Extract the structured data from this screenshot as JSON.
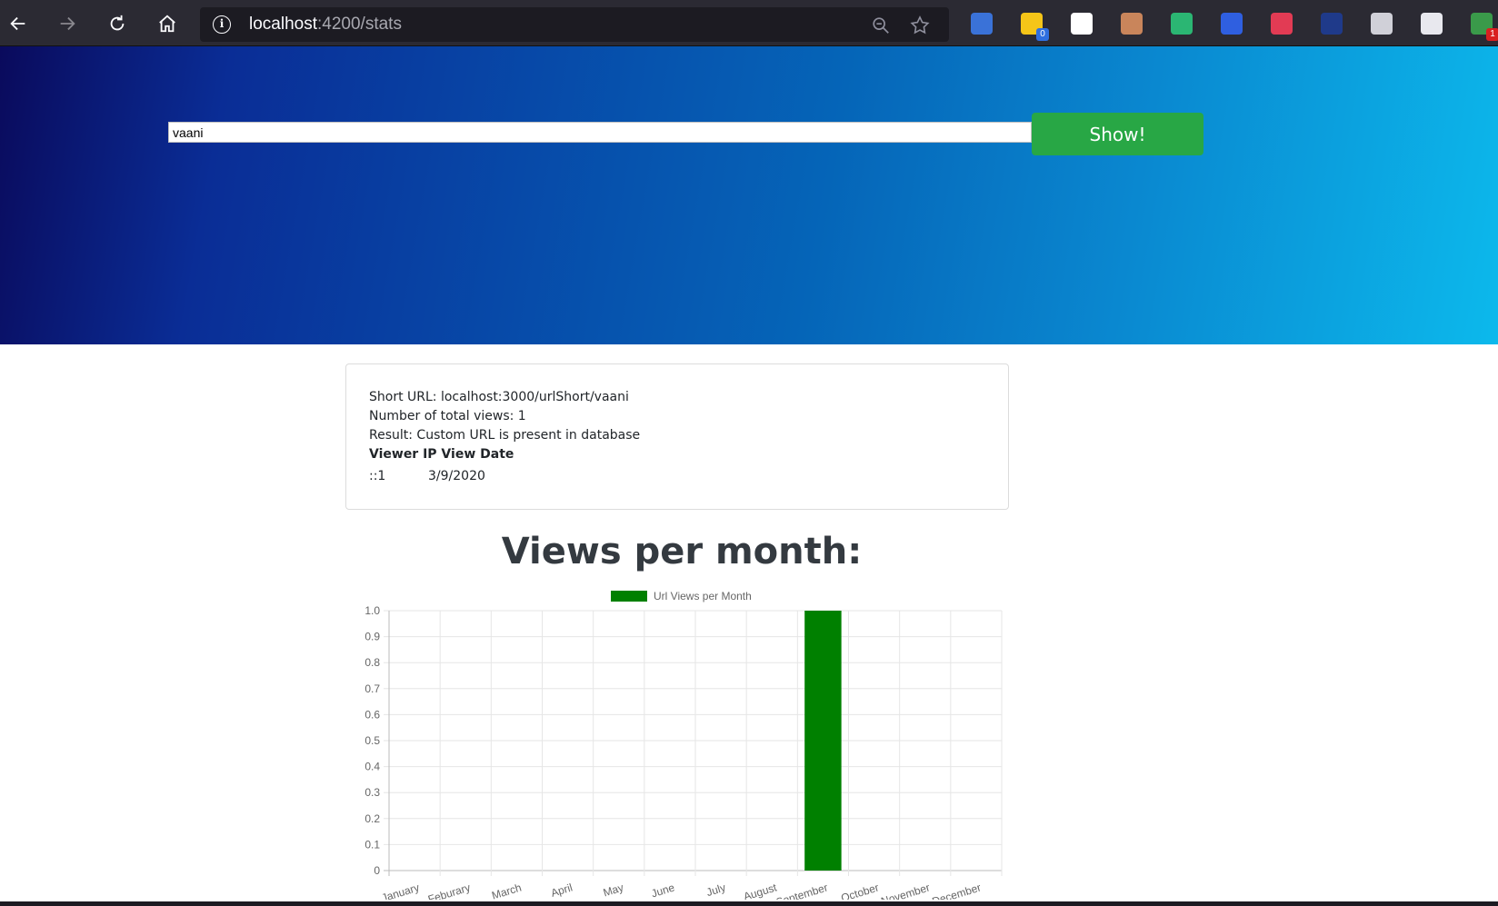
{
  "browser": {
    "url_host": "localhost",
    "url_path": ":4200/stats",
    "extensions": [
      {
        "name": "translate-extension-icon",
        "color": "#3a72d8"
      },
      {
        "name": "notes-extension-icon",
        "color": "#f5c518",
        "badge": "0",
        "badge_color": "#2f6fe0"
      },
      {
        "name": "gem-extension-icon",
        "color": "#ffffff"
      },
      {
        "name": "owl-extension-icon",
        "color": "#c9855b"
      },
      {
        "name": "compass-extension-icon",
        "color": "#2bb673"
      },
      {
        "name": "d-extension-icon",
        "color": "#2f5fe0"
      },
      {
        "name": "dots-extension-icon",
        "color": "#e23b54"
      },
      {
        "name": "magnifier-extension-icon",
        "color": "#1f3a8a"
      },
      {
        "name": "pocket-extension-icon",
        "color": "#d0d0d8"
      },
      {
        "name": "mail-extension-icon",
        "color": "#e8e8ee"
      },
      {
        "name": "puzzle-extension-icon",
        "color": "#3a9a4a",
        "badge": "1",
        "badge_color": "#d92020"
      }
    ]
  },
  "search": {
    "value": "vaani",
    "button_label": "Show!"
  },
  "card": {
    "short_url": "Short URL: localhost:3000/urlShort/vaani",
    "total_views": "Number of total views: 1",
    "result": "Result: Custom URL is present in database",
    "header": "Viewer IP View Date",
    "rows": [
      {
        "ip": "::1",
        "date": "3/9/2020"
      }
    ]
  },
  "chart_title": "Views per month:",
  "chart_data": {
    "type": "bar",
    "categories": [
      "January",
      "Feburary",
      "March",
      "April",
      "May",
      "June",
      "July",
      "August",
      "September",
      "October",
      "November",
      "December"
    ],
    "series": [
      {
        "name": "Url Views per Month",
        "values": [
          0,
          0,
          0,
          0,
          0,
          0,
          0,
          0,
          1,
          0,
          0,
          0
        ],
        "color": "#008000"
      }
    ],
    "ylim": [
      0,
      1
    ],
    "yticks": [
      "0",
      "0.1",
      "0.2",
      "0.3",
      "0.4",
      "0.5",
      "0.6",
      "0.7",
      "0.8",
      "0.9",
      "1.0"
    ],
    "grid": true,
    "legend_position": "top"
  }
}
